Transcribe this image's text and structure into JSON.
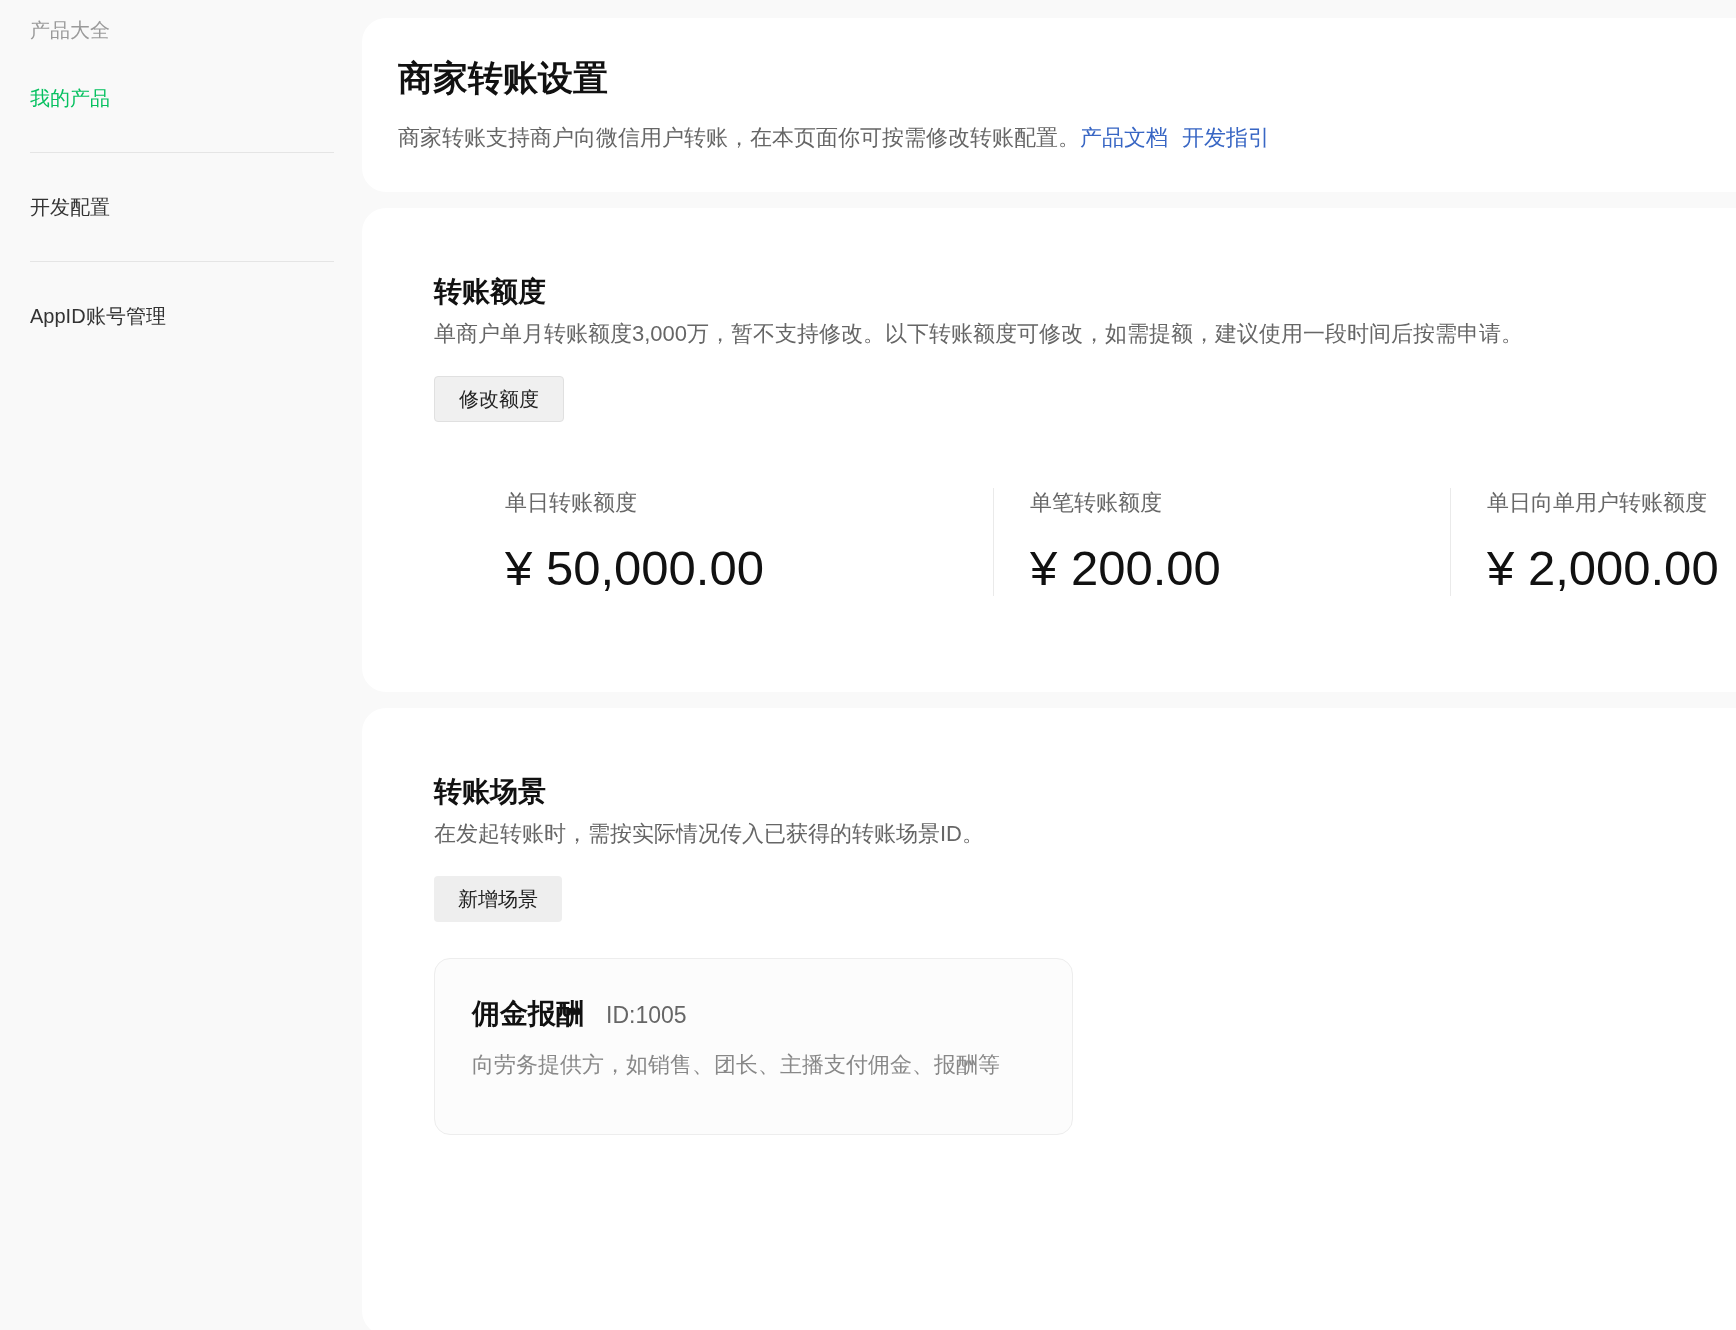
{
  "sidebar": {
    "heading": "产品大全",
    "items": [
      {
        "label": "我的产品",
        "selected": true
      },
      {
        "label": "开发配置",
        "selected": false
      },
      {
        "label": "AppID账号管理",
        "selected": false
      }
    ]
  },
  "header": {
    "title": "商家转账设置",
    "description": "商家转账支持商户向微信用户转账，在本页面你可按需修改转账配置。",
    "links": [
      "产品文档",
      "开发指引"
    ]
  },
  "limits": {
    "title": "转账额度",
    "description": "单商户单月转账额度3,000万，暂不支持修改。以下转账额度可修改，如需提额，建议使用一段时间后按需申请。",
    "button": "修改额度",
    "stats": [
      {
        "label": "单日转账额度",
        "currency": "¥",
        "value": "50,000.00"
      },
      {
        "label": "单笔转账额度",
        "currency": "¥",
        "value": "200.00"
      },
      {
        "label": "单日向单用户转账额度",
        "currency": "¥",
        "value": "2,000.00"
      }
    ]
  },
  "scenes": {
    "title": "转账场景",
    "description": "在发起转账时，需按实际情况传入已获得的转账场景ID。",
    "button": "新增场景",
    "cards": [
      {
        "name": "佣金报酬",
        "id": "ID:1005",
        "description": "向劳务提供方，如销售、团长、主播支付佣金、报酬等"
      }
    ]
  }
}
